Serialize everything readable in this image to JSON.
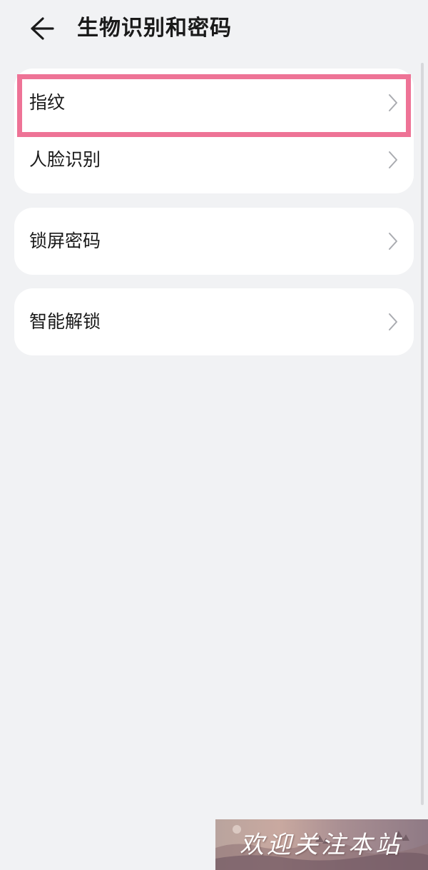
{
  "header": {
    "title": "生物识别和密码",
    "back_icon": "arrow-left-icon"
  },
  "cards": [
    {
      "items": [
        {
          "label": "指纹"
        },
        {
          "label": "人脸识别"
        }
      ]
    },
    {
      "items": [
        {
          "label": "锁屏密码"
        }
      ]
    },
    {
      "items": [
        {
          "label": "智能解锁"
        }
      ]
    }
  ],
  "highlight": {
    "target": "指纹",
    "color": "#ee7396"
  },
  "watermark": {
    "text": "欢迎关注本站"
  }
}
